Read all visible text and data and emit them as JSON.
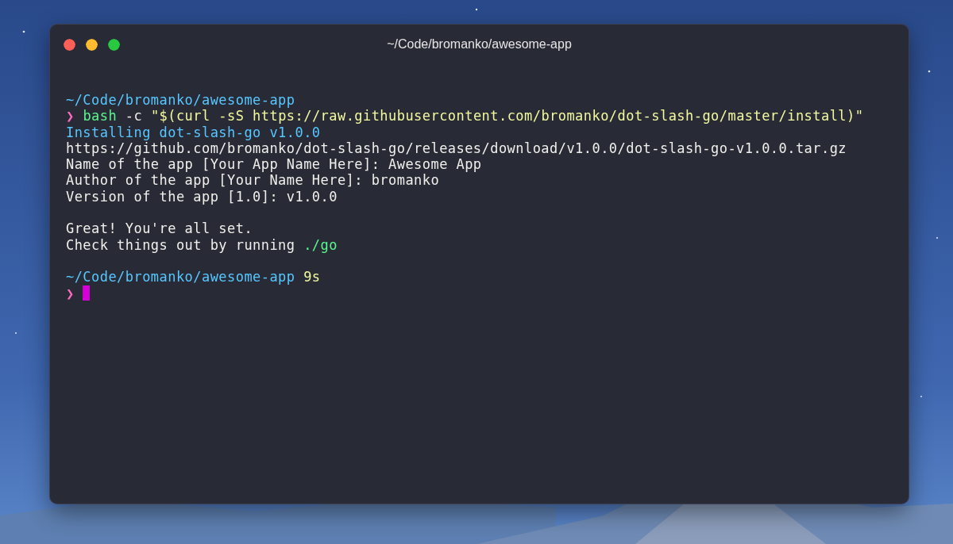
{
  "window": {
    "title": "~/Code/bromanko/awesome-app"
  },
  "terminal": {
    "blocks": [
      {
        "lines": [
          {
            "segments": [
              {
                "text": "~/Code/bromanko/awesome-app",
                "color": "#57c7ff"
              }
            ]
          },
          {
            "segments": [
              {
                "text": "❯",
                "color": "#ff6ac1"
              },
              {
                "text": "bash",
                "color": "#5af78e"
              },
              {
                "text": "-c",
                "color": "#eff0eb"
              },
              {
                "text": "\"$(curl -sS https://raw.githubusercontent.com/bromanko/dot-slash-go/master/install)\"",
                "color": "#f3f99d"
              }
            ]
          },
          {
            "segments": [
              {
                "text": "Installing dot-slash-go v1.0.0",
                "color": "#57c7ff"
              }
            ]
          },
          {
            "segments": [
              {
                "text": "https://github.com/bromanko/dot-slash-go/releases/download/v1.0.0/dot-slash-go-v1.0.0.tar.gz",
                "color": "#eff0eb"
              }
            ]
          },
          {
            "segments": [
              {
                "text": "Name of the app [Your App Name Here]: Awesome App",
                "color": "#eff0eb"
              }
            ]
          },
          {
            "segments": [
              {
                "text": "Author of the app [Your Name Here]: bromanko",
                "color": "#eff0eb"
              }
            ]
          },
          {
            "segments": [
              {
                "text": "Version of the app [1.0]: v1.0.0",
                "color": "#eff0eb"
              }
            ]
          }
        ]
      },
      {
        "lines": [
          {
            "segments": [
              {
                "text": "Great! You're all set.",
                "color": "#eff0eb"
              }
            ]
          },
          {
            "segments": [
              {
                "text": "Check things out by running",
                "color": "#eff0eb"
              },
              {
                "text": "./go",
                "color": "#5af78e"
              }
            ]
          }
        ]
      },
      {
        "lines": [
          {
            "segments": [
              {
                "text": "~/Code/bromanko/awesome-app",
                "color": "#57c7ff"
              },
              {
                "text": "9s",
                "color": "#f3f99d"
              }
            ]
          },
          {
            "segments": [
              {
                "text": "❯",
                "color": "#ff6ac1"
              }
            ],
            "cursor": true
          }
        ]
      }
    ]
  }
}
